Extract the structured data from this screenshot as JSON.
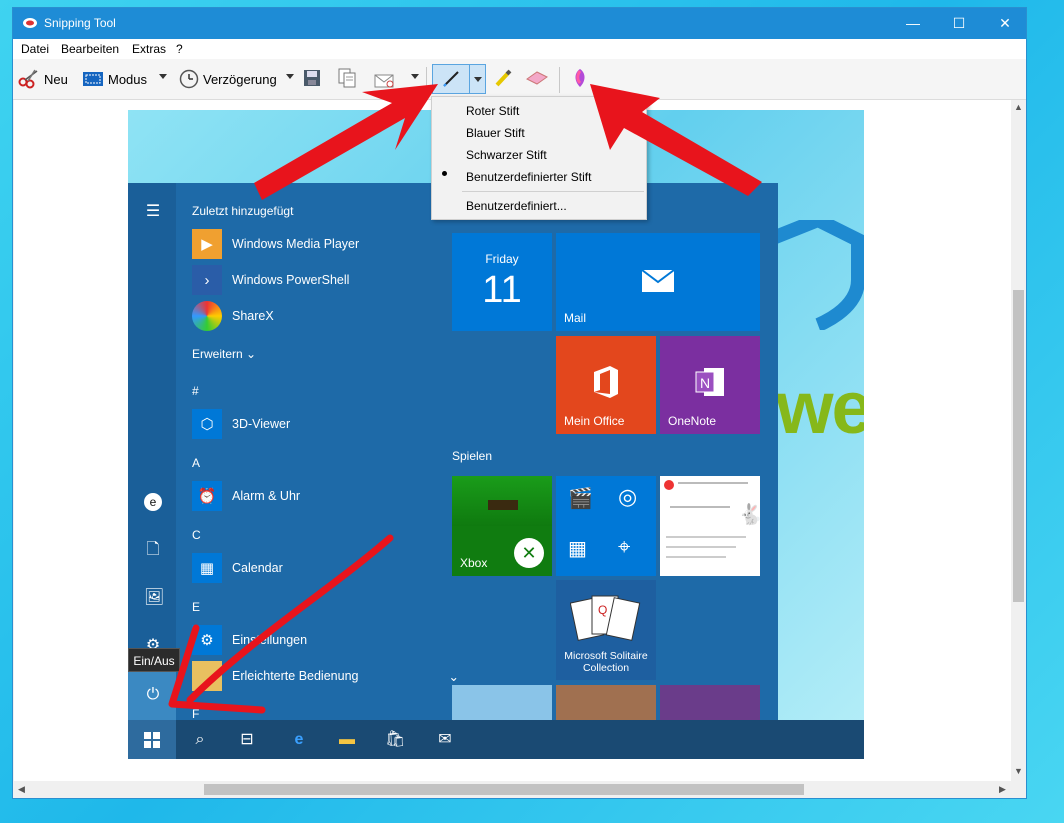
{
  "window": {
    "title": "Snipping Tool",
    "minimize": "—",
    "maximize": "☐",
    "close": "✕"
  },
  "menu": [
    "Datei",
    "Bearbeiten",
    "Extras",
    "?"
  ],
  "toolbar": {
    "new_label": "Neu",
    "mode_label": "Modus",
    "delay_label": "Verzögerung"
  },
  "pen_menu": {
    "items": [
      "Roter Stift",
      "Blauer Stift",
      "Schwarzer Stift",
      "Benutzerdefinierter Stift"
    ],
    "selected_index": 3,
    "customize": "Benutzerdefiniert..."
  },
  "startmenu": {
    "recent_header": "Zuletzt hinzugefügt",
    "recent": [
      "Windows Media Player",
      "Windows PowerShell",
      "ShareX"
    ],
    "expand": "Erweitern",
    "groups": [
      {
        "letter": "#",
        "apps": [
          "3D-Viewer"
        ]
      },
      {
        "letter": "A",
        "apps": [
          "Alarm & Uhr"
        ]
      },
      {
        "letter": "C",
        "apps": [
          "Calendar"
        ]
      },
      {
        "letter": "E",
        "apps": [
          "Einstellungen",
          "Erleichterte Bedienung"
        ]
      },
      {
        "letter": "F",
        "apps": []
      }
    ],
    "tiles": {
      "day": "Friday",
      "date": "11",
      "mail": "Mail",
      "office": "Mein Office",
      "onenote": "OneNote",
      "games_header": "Spielen",
      "xbox": "Xbox",
      "solitaire": "Microsoft Solitaire Collection"
    },
    "power_tooltip": "Ein/Aus"
  },
  "background_text": "we",
  "colors": {
    "titlebar": "#1e8cd6",
    "startmenu": "#1e6aa8",
    "tile_blue": "#0078d7",
    "tile_office": "#e3471d",
    "tile_onenote": "#7b2fa0",
    "tile_xbox": "#107c10",
    "arrow": "#e8141c"
  }
}
